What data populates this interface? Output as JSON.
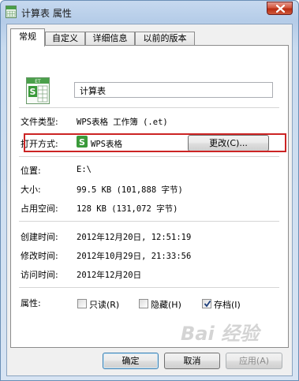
{
  "window": {
    "title": "计算表 属性",
    "close_icon": "close-icon"
  },
  "tabs": [
    {
      "label": "常规",
      "active": true
    },
    {
      "label": "自定义",
      "active": false
    },
    {
      "label": "详细信息",
      "active": false
    },
    {
      "label": "以前的版本",
      "active": false
    }
  ],
  "general": {
    "file_icon": "spreadsheet-file-icon",
    "file_name": "计算表",
    "file_type_label": "文件类型:",
    "file_type_value": "WPS表格 工作簿 (.et)",
    "open_with_label": "打开方式:",
    "open_with_icon": "wps-spreadsheet-icon",
    "open_with_value": "WPS表格",
    "change_button": "更改(C)...",
    "location_label": "位置:",
    "location_value": "E:\\",
    "size_label": "大小:",
    "size_value": "99.5 KB (101,888 字节)",
    "disk_size_label": "占用空间:",
    "disk_size_value": "128 KB (131,072 字节)",
    "created_label": "创建时间:",
    "created_value": "2012年12月20日, 12:51:19",
    "modified_label": "修改时间:",
    "modified_value": "2012年10月29日, 21:33:56",
    "accessed_label": "访问时间:",
    "accessed_value": "2012年12月20日",
    "attributes_label": "属性:",
    "attributes": [
      {
        "label": "只读(R)",
        "checked": false
      },
      {
        "label": "隐藏(H)",
        "checked": false
      },
      {
        "label": "存档(I)",
        "checked": true
      }
    ]
  },
  "buttons": {
    "ok": "确定",
    "cancel": "取消",
    "apply": "应用(A)"
  },
  "watermark": "Bai 经验",
  "colors": {
    "highlight_border": "#cc2424",
    "title_bar": "#c6d9ef",
    "close_button": "#c7462c",
    "wps_green": "#3a9a3a"
  }
}
